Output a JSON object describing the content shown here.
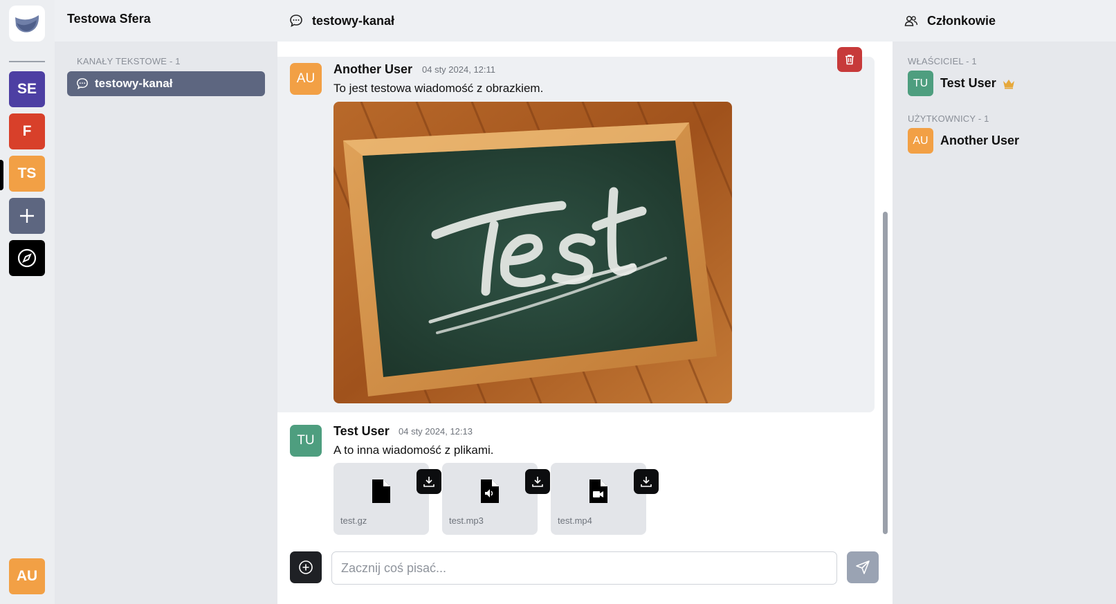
{
  "rail": {
    "servers": [
      {
        "initials": "SE",
        "color": "#4d3fa3"
      },
      {
        "initials": "F",
        "color": "#d8402a"
      },
      {
        "initials": "TS",
        "color": "#f2a045"
      }
    ],
    "add_label": "+",
    "current_user": {
      "initials": "AU",
      "color": "#f2a045"
    }
  },
  "sidebar": {
    "server_name": "Testowa Sfera",
    "section_label": "KANAŁY TEKSTOWE - 1",
    "channels": [
      {
        "name": "testowy-kanał",
        "active": true
      }
    ]
  },
  "chat": {
    "channel_name": "testowy-kanał",
    "messages": [
      {
        "author": "Another User",
        "initials": "AU",
        "avatar_color": "#f2a045",
        "timestamp": "04 sty 2024, 12:11",
        "text": "To jest testowa wiadomość z obrazkiem.",
        "image_text": "Test",
        "highlighted": true
      },
      {
        "author": "Test User",
        "initials": "TU",
        "avatar_color": "#4e9e7f",
        "timestamp": "04 sty 2024, 12:13",
        "text": "A to inna wiadomość z plikami.",
        "files": [
          {
            "name": "test.gz",
            "icon": "file-icon"
          },
          {
            "name": "test.mp3",
            "icon": "audio-file-icon"
          },
          {
            "name": "test.mp4",
            "icon": "video-file-icon"
          }
        ]
      }
    ],
    "composer_placeholder": "Zacznij coś pisać..."
  },
  "members": {
    "title": "Członkowie",
    "owner_label": "WŁAŚCICIEL - 1",
    "owners": [
      {
        "name": "Test User",
        "initials": "TU",
        "color": "#4e9e7f",
        "badge": "crown-icon"
      }
    ],
    "users_label": "UŻYTKOWNICY - 1",
    "users": [
      {
        "name": "Another User",
        "initials": "AU",
        "color": "#f2a045"
      }
    ]
  },
  "colors": {
    "accent_active_channel": "#5d6680",
    "delete": "#c73a3a",
    "crown": "#e6a83a"
  }
}
